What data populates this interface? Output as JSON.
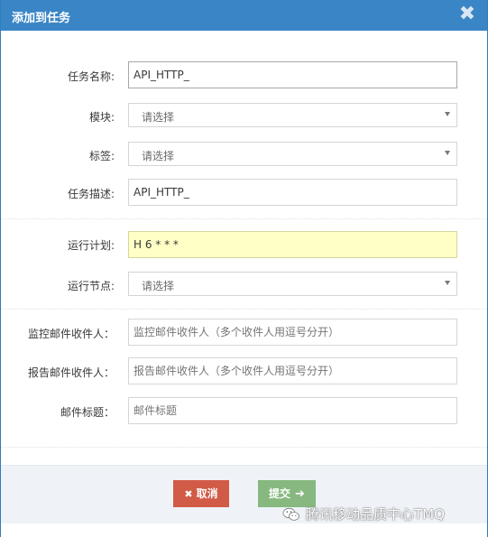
{
  "dialog": {
    "title": "添加到任务",
    "close_glyph": "✖",
    "close_icon": "close-icon"
  },
  "form": {
    "task_name_label": "任务名称:",
    "task_name_value": "API_HTTP_",
    "module_label": "模块:",
    "module_value": "请选择",
    "tag_label": "标签:",
    "tag_value": "请选择",
    "task_desc_label": "任务描述:",
    "task_desc_value": "API_HTTP_",
    "schedule_label": "运行计划:",
    "schedule_value": "H 6 * * *",
    "node_label": "运行节点:",
    "node_value": "请选择",
    "monitor_label": "监控邮件收件人：",
    "monitor_placeholder": "监控邮件收件人（多个收件人用逗号分开）",
    "report_label": "报告邮件收件人：",
    "report_placeholder": "报告邮件收件人（多个收件人用逗号分开）",
    "subject_label": "邮件标题：",
    "subject_placeholder": "邮件标题"
  },
  "footer": {
    "cancel_label": "取消",
    "cancel_glyph": "✖",
    "submit_label": "提交",
    "submit_glyph": "➔"
  },
  "watermark": {
    "text": "腾讯移动品质中心TMQ",
    "icon": "wechat-icon"
  },
  "colors": {
    "header": "#3a85c6",
    "cancel": "#d15b47",
    "submit": "#87b87f",
    "highlight_field": "#ffffc6",
    "footer_bg": "#eff3f8"
  }
}
